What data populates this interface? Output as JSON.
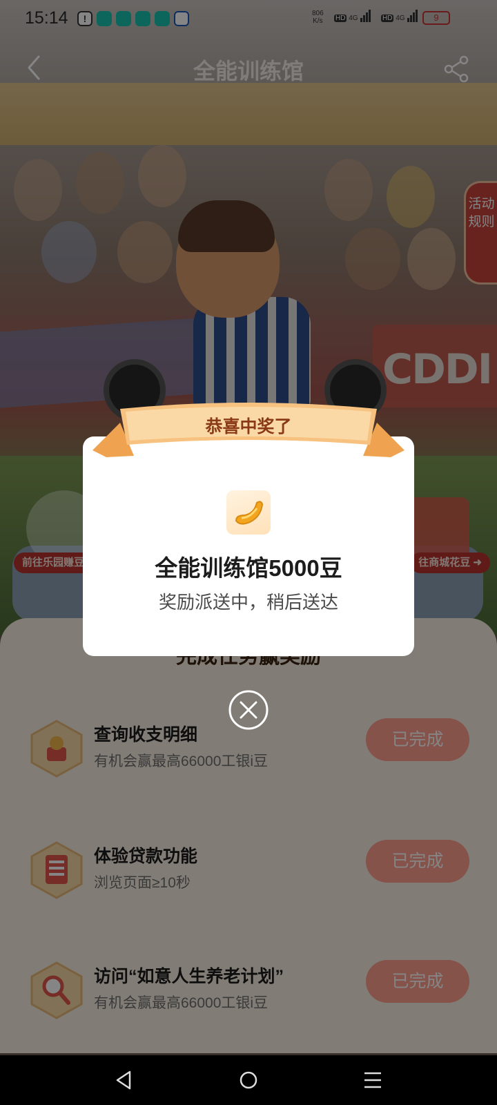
{
  "status_bar": {
    "time": "15:14",
    "net_speed_value": "806",
    "net_speed_unit": "K/s",
    "sim1_tag": "HD",
    "sim1_network": "4G",
    "sim2_tag": "HD",
    "sim2_network": "4G",
    "battery_level": "9",
    "notification_icons": [
      "alert-icon",
      "chat-icon",
      "chat-icon",
      "chat-icon",
      "chat-icon",
      "browser-icon"
    ]
  },
  "header": {
    "title": "全能训练馆",
    "back_icon": "chevron-left-icon",
    "share_icon": "share-icon"
  },
  "side_tab": {
    "label": "活动规则"
  },
  "scene": {
    "banner_text": "CDDI",
    "left_link": "前往乐园赚豆",
    "right_link": "往商城花豆"
  },
  "tasks": {
    "section_title": "完成任务赢奖励",
    "items": [
      {
        "title": "查询收支明细",
        "subtitle": "有机会赢最高66000工银i豆",
        "button": "已完成",
        "icon": "coin-chart-icon"
      },
      {
        "title": "体验贷款功能",
        "subtitle": "浏览页面≥10秒",
        "button": "已完成",
        "icon": "clipboard-icon"
      },
      {
        "title": "访问“如意人生养老计划”",
        "subtitle": "有机会赢最高66000工银i豆",
        "button": "已完成",
        "icon": "magnifier-icon"
      }
    ]
  },
  "modal": {
    "ribbon": "恭喜中奖了",
    "prize": "全能训练馆5000豆",
    "message": "奖励派送中，稍后送达",
    "icon": "bean-icon"
  },
  "colors": {
    "accent": "#c9443a",
    "button_done": "#ff9f8e",
    "ribbon": "#f3b468",
    "panel_bg": "#f7efe2"
  }
}
